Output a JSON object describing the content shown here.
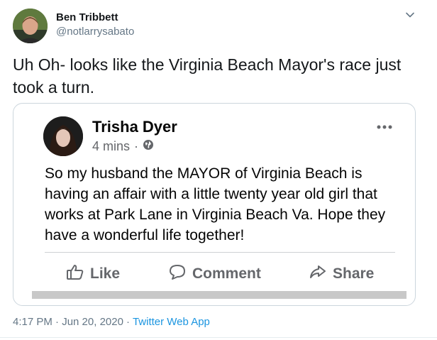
{
  "tweet": {
    "author": {
      "name": "Ben Tribbett",
      "handle": "@notlarrysabato",
      "avatar_icon": "profile-photo"
    },
    "caret_icon": "chevron-down-icon",
    "text": "Uh Oh- looks like the Virginia Beach Mayor's race just took a turn.",
    "timestamp": "4:17 PM · Jun 20, 2020",
    "separator": "·",
    "source": "Twitter Web App"
  },
  "embed": {
    "author": {
      "name": "Trisha Dyer",
      "time": "4 mins",
      "separator": "·",
      "privacy_icon": "globe-icon"
    },
    "menu_icon": "more-options-icon",
    "text": "So my husband the MAYOR of Virginia Beach is having an affair with a little twenty year old girl that works at Park Lane in Virginia Beach Va. Hope they have a wonderful life together!",
    "actions": [
      {
        "label": "Like",
        "icon": "thumbs-up-icon"
      },
      {
        "label": "Comment",
        "icon": "comment-icon"
      },
      {
        "label": "Share",
        "icon": "share-arrow-icon"
      }
    ]
  },
  "colors": {
    "name": "#14171a",
    "secondary": "#657786",
    "link": "#1b95e0",
    "fb_gray": "#65676b",
    "border": "#ccd6dd"
  }
}
